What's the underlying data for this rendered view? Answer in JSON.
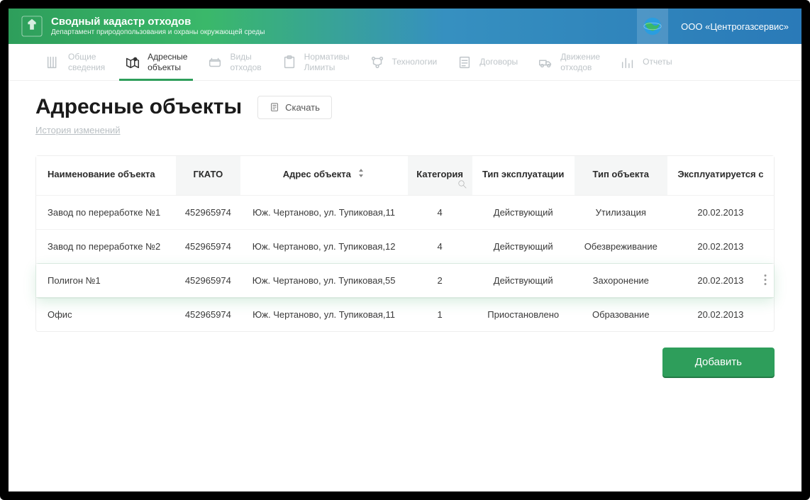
{
  "header": {
    "title": "Сводный кадастр отходов",
    "subtitle": "Департамент природопользования и охраны окружающей среды",
    "company": "ООО  «Центрогазсервис»"
  },
  "nav": [
    {
      "id": "general",
      "l1": "Общие",
      "l2": "сведения"
    },
    {
      "id": "address",
      "l1": "Адресные",
      "l2": "объекты",
      "active": true
    },
    {
      "id": "waste",
      "l1": "Виды",
      "l2": "отходов"
    },
    {
      "id": "limits",
      "l1": "Нормативы",
      "l2": "Лимиты"
    },
    {
      "id": "tech",
      "l1": "Технологии",
      "l2": ""
    },
    {
      "id": "contracts",
      "l1": "Договоры",
      "l2": ""
    },
    {
      "id": "movement",
      "l1": "Движение",
      "l2": "отходов"
    },
    {
      "id": "reports",
      "l1": "Отчеты",
      "l2": ""
    }
  ],
  "page": {
    "title": "Адресные объекты",
    "download": "Скачать",
    "history": "История изменений",
    "add": "Добавить"
  },
  "columns": {
    "name": "Наименование объекта",
    "gkato": "ГКАТО",
    "address": "Адрес объекта",
    "category": "Категория",
    "operation": "Тип эксплуатации",
    "type": "Тип объекта",
    "since": "Эксплуатируется с"
  },
  "rows": [
    {
      "name": "Завод по переработке №1",
      "gkato": "452965974",
      "address": "Юж. Чертаново, ул. Тупиковая,11",
      "category": "4",
      "operation": "Действующий",
      "type": "Утилизация",
      "since": "20.02.2013"
    },
    {
      "name": "Завод по переработке №2",
      "gkato": "452965974",
      "address": "Юж. Чертаново, ул. Тупиковая,12",
      "category": "4",
      "operation": "Действующий",
      "type": "Обезвреживание",
      "since": "20.02.2013"
    },
    {
      "name": "Полигон №1",
      "gkato": "452965974",
      "address": "Юж. Чертаново, ул. Тупиковая,55",
      "category": "2",
      "operation": "Действующий",
      "type": "Захоронение",
      "since": "20.02.2013",
      "highlight": true
    },
    {
      "name": "Офис",
      "gkato": "452965974",
      "address": "Юж. Чертаново, ул. Тупиковая,11",
      "category": "1",
      "operation": "Приостановлено",
      "type": "Образование",
      "since": "20.02.2013"
    }
  ]
}
